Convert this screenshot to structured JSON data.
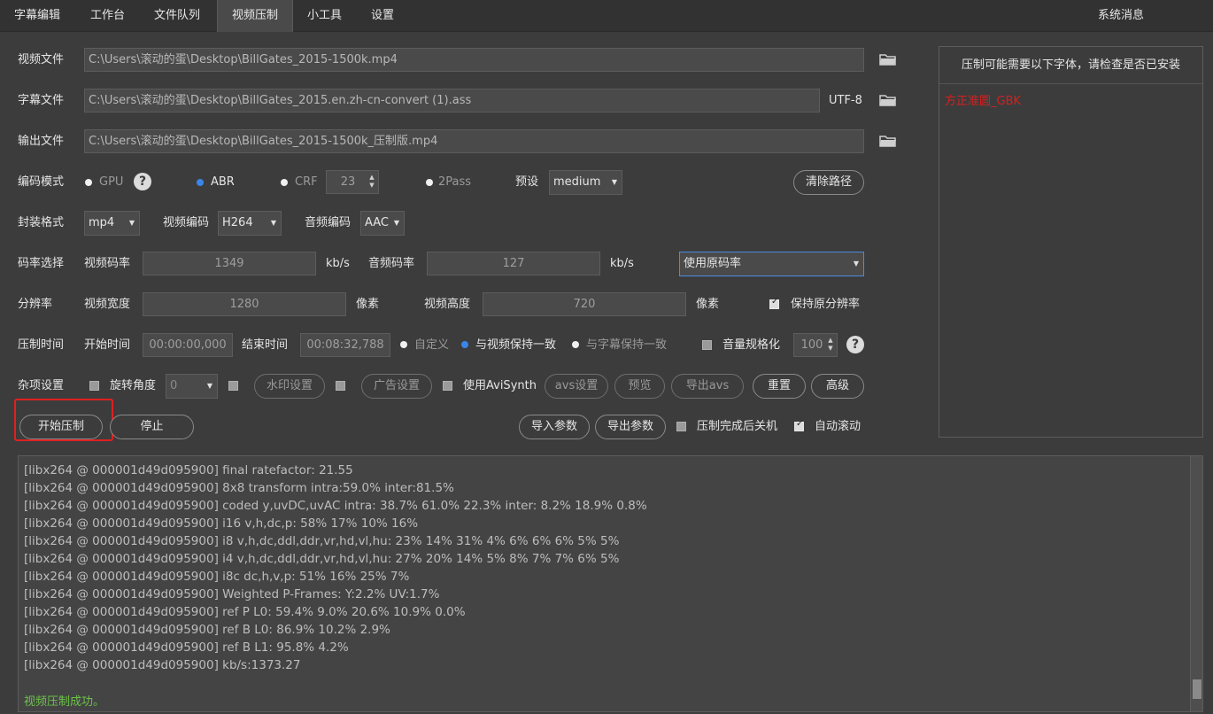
{
  "tabs": [
    "字幕编辑",
    "工作台",
    "文件队列",
    "视频压制",
    "小工具",
    "设置"
  ],
  "system_messages": "系统消息",
  "files": {
    "video_label": "视频文件",
    "video_path": "C:\\Users\\滚动的蛋\\Desktop\\BillGates_2015-1500k.mp4",
    "subtitle_label": "字幕文件",
    "subtitle_path": "C:\\Users\\滚动的蛋\\Desktop\\BillGates_2015.en.zh-cn-convert (1).ass",
    "subtitle_encoding": "UTF-8",
    "output_label": "输出文件",
    "output_path": "C:\\Users\\滚动的蛋\\Desktop\\BillGates_2015-1500k_压制版.mp4"
  },
  "encode": {
    "label": "编码模式",
    "gpu": "GPU",
    "abr": "ABR",
    "crf": "CRF",
    "crf_value": "23",
    "twopass": "2Pass",
    "preset_label": "预设",
    "preset_value": "medium",
    "clear_path": "清除路径"
  },
  "container": {
    "label": "封装格式",
    "format": "mp4",
    "video_codec_label": "视频编码",
    "video_codec": "H264",
    "audio_codec_label": "音频编码",
    "audio_codec": "AAC"
  },
  "bitrate": {
    "label": "码率选择",
    "video_label": "视频码率",
    "video_value": "1349",
    "unit": "kb/s",
    "audio_label": "音频码率",
    "audio_value": "127",
    "audio_unit": "kb/s",
    "mode": "使用原码率"
  },
  "resolution": {
    "label": "分辨率",
    "width_label": "视频宽度",
    "width": "1280",
    "unit": "像素",
    "height_label": "视频高度",
    "height": "720",
    "height_unit": "像素",
    "keep": "保持原分辨率"
  },
  "time": {
    "label": "压制时间",
    "start_label": "开始时间",
    "start": "00:00:00,000",
    "end_label": "结束时间",
    "end": "00:08:32,788",
    "custom": "自定义",
    "match_video": "与视频保持一致",
    "match_subtitle": "与字幕保持一致",
    "normalize": "音量规格化",
    "normalize_value": "100"
  },
  "misc": {
    "label": "杂项设置",
    "rotate_label": "旋转角度",
    "rotate_value": "0",
    "watermark": "水印设置",
    "ad": "广告设置",
    "avisynth": "使用AviSynth",
    "avs_settings": "avs设置",
    "preview": "预览",
    "export_avs": "导出avs",
    "reset": "重置",
    "advanced": "高级"
  },
  "actions": {
    "start": "开始压制",
    "stop": "停止",
    "import": "导入参数",
    "export": "导出参数",
    "shutdown": "压制完成后关机",
    "autoscroll": "自动滚动"
  },
  "panel": {
    "title": "压制可能需要以下字体，请检查是否已安装",
    "font": "方正准圆_GBK"
  },
  "log": {
    "lines": [
      "[libx264 @ 000001d49d095900] final ratefactor: 21.55",
      "[libx264 @ 000001d49d095900] 8x8 transform intra:59.0% inter:81.5%",
      "[libx264 @ 000001d49d095900] coded y,uvDC,uvAC intra: 38.7% 61.0% 22.3% inter: 8.2% 18.9% 0.8%",
      "[libx264 @ 000001d49d095900] i16 v,h,dc,p: 58% 17% 10% 16%",
      "[libx264 @ 000001d49d095900] i8 v,h,dc,ddl,ddr,vr,hd,vl,hu: 23% 14% 31%  4%  6%  6%  6%  5%  5%",
      "[libx264 @ 000001d49d095900] i4 v,h,dc,ddl,ddr,vr,hd,vl,hu: 27% 20% 14%  5%  8%  7%  7%  6%  5%",
      "[libx264 @ 000001d49d095900] i8c dc,h,v,p: 51% 16% 25%  7%",
      "[libx264 @ 000001d49d095900] Weighted P-Frames: Y:2.2% UV:1.7%",
      "[libx264 @ 000001d49d095900] ref P L0: 59.4%  9.0% 20.6% 10.9%  0.0%",
      "[libx264 @ 000001d49d095900] ref B L0: 86.9% 10.2%  2.9%",
      "[libx264 @ 000001d49d095900] ref B L1: 95.8%  4.2%",
      "[libx264 @ 000001d49d095900] kb/s:1373.27"
    ],
    "success": "视频压制成功。"
  }
}
